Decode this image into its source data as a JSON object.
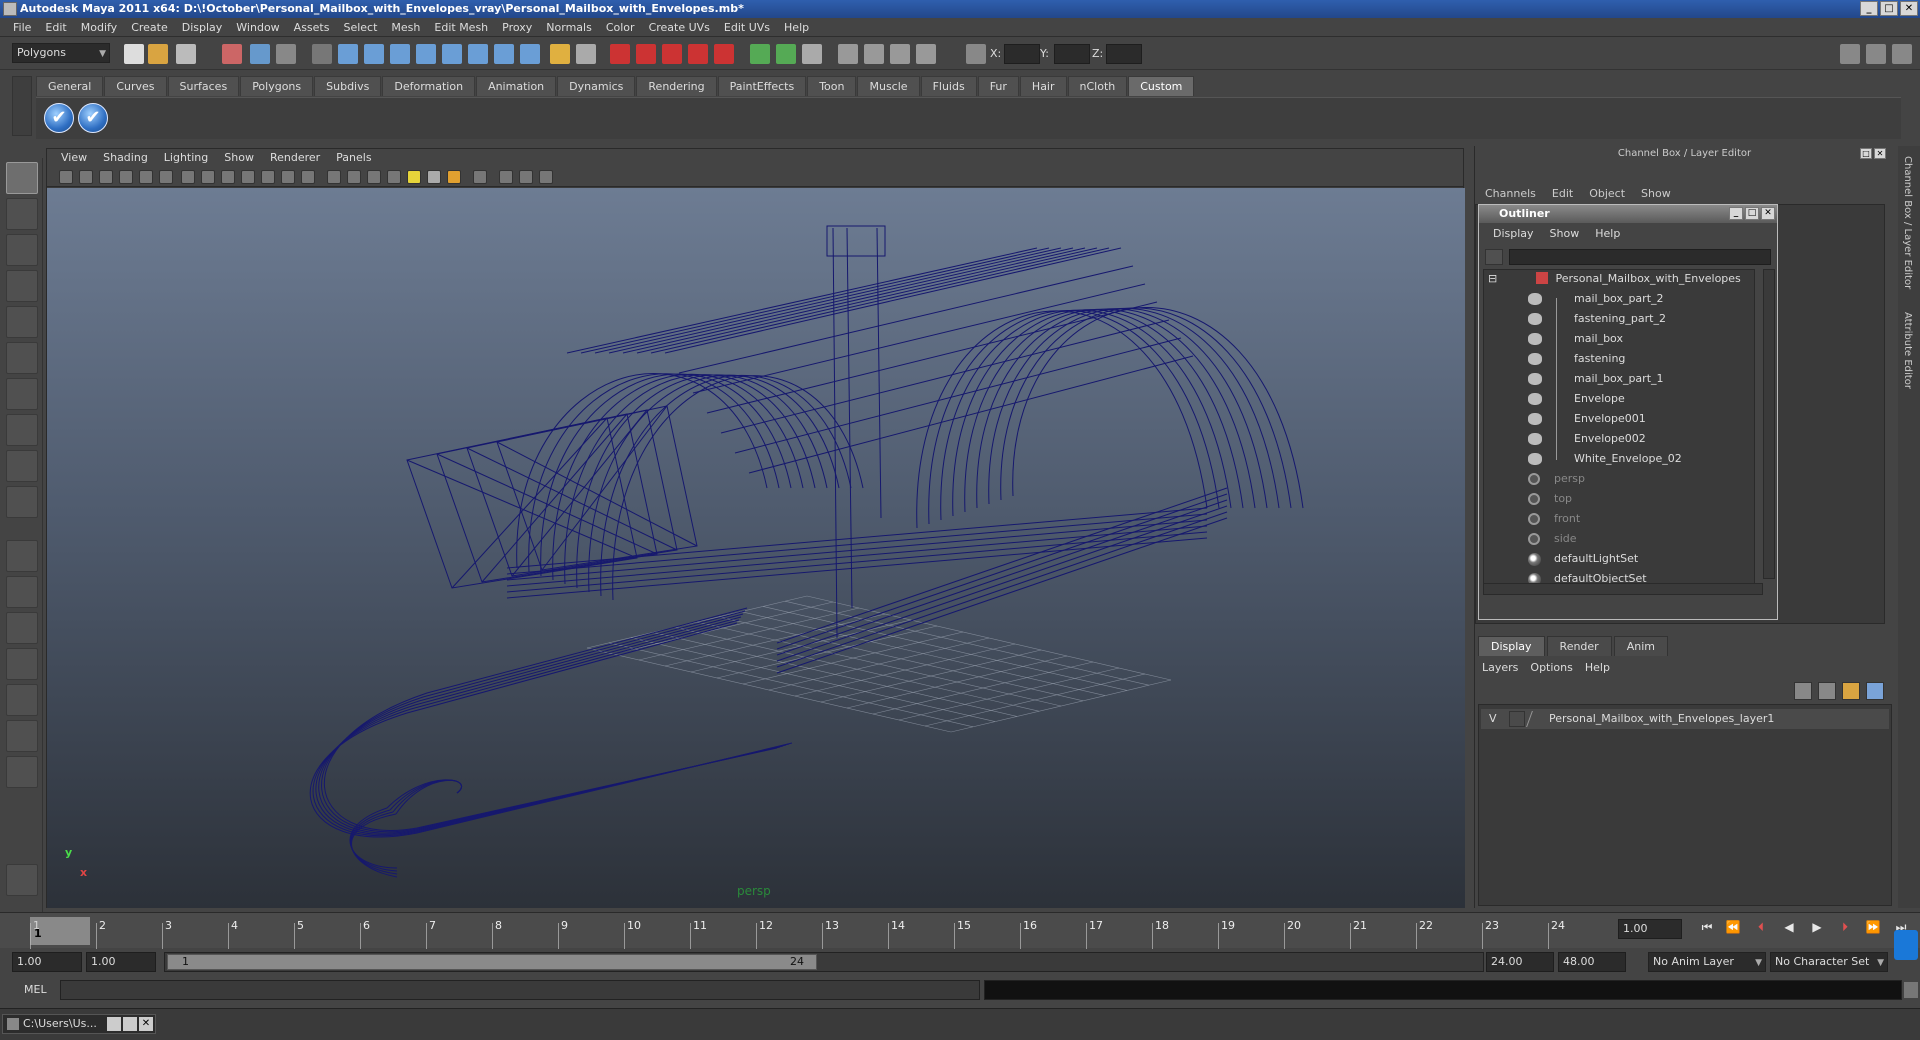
{
  "window": {
    "title": "Autodesk Maya 2011 x64: D:\\!October\\Personal_Mailbox_with_Envelopes_vray\\Personal_Mailbox_with_Envelopes.mb*",
    "minimize": "_",
    "maximize": "□",
    "close": "✕"
  },
  "menubar": [
    "File",
    "Edit",
    "Modify",
    "Create",
    "Display",
    "Window",
    "Assets",
    "Select",
    "Mesh",
    "Edit Mesh",
    "Proxy",
    "Normals",
    "Color",
    "Create UVs",
    "Edit UVs",
    "Help"
  ],
  "statusline": {
    "mode": "Polygons",
    "x_label": "X:",
    "y_label": "Y:",
    "z_label": "Z:"
  },
  "shelf": {
    "tabs": [
      "General",
      "Curves",
      "Surfaces",
      "Polygons",
      "Subdivs",
      "Deformation",
      "Animation",
      "Dynamics",
      "Rendering",
      "PaintEffects",
      "Toon",
      "Muscle",
      "Fluids",
      "Fur",
      "Hair",
      "nCloth",
      "Custom"
    ],
    "active_tab": "Custom",
    "buttons": [
      "✔",
      "✔"
    ]
  },
  "viewport": {
    "menu": [
      "View",
      "Shading",
      "Lighting",
      "Show",
      "Renderer",
      "Panels"
    ],
    "camera": "persp",
    "axis_y": "y",
    "axis_x": "x",
    "wire_color": "#16186e"
  },
  "channelbox": {
    "title": "Channel Box / Layer Editor",
    "menu": [
      "Channels",
      "Edit",
      "Object",
      "Show"
    ],
    "side_tab_1": "Channel Box / Layer Editor",
    "side_tab_2": "Attribute Editor"
  },
  "outliner": {
    "title": "Outliner",
    "menu": [
      "Display",
      "Show",
      "Help"
    ],
    "root": "Personal_Mailbox_with_Envelopes",
    "children": [
      "mail_box_part_2",
      "fastening_part_2",
      "mail_box",
      "fastening",
      "mail_box_part_1",
      "Envelope",
      "Envelope001",
      "Envelope002",
      "White_Envelope_02"
    ],
    "cameras": [
      "persp",
      "top",
      "front",
      "side"
    ],
    "sets": [
      "defaultLightSet",
      "defaultObjectSet"
    ]
  },
  "layer_editor": {
    "tabs": [
      "Display",
      "Render",
      "Anim"
    ],
    "active_tab": "Display",
    "menu": [
      "Layers",
      "Options",
      "Help"
    ],
    "visibility": "V",
    "layer_name": "Personal_Mailbox_with_Envelopes_layer1"
  },
  "timeline": {
    "ticks": [
      "1",
      "2",
      "3",
      "4",
      "5",
      "6",
      "7",
      "8",
      "9",
      "10",
      "11",
      "12",
      "13",
      "14",
      "15",
      "16",
      "17",
      "18",
      "19",
      "20",
      "21",
      "22",
      "23",
      "24"
    ],
    "current_frame_label": "1",
    "current_time": "1.00"
  },
  "range": {
    "start_time": "1.00",
    "playback_start": "1.00",
    "range_start": "1",
    "range_end": "24",
    "playback_end": "24.00",
    "end_time": "48.00",
    "anim_layer": "No Anim Layer",
    "char_set": "No Character Set"
  },
  "cmdline": {
    "label": "MEL"
  },
  "taskbar": {
    "item": "C:\\Users\\Us..."
  }
}
